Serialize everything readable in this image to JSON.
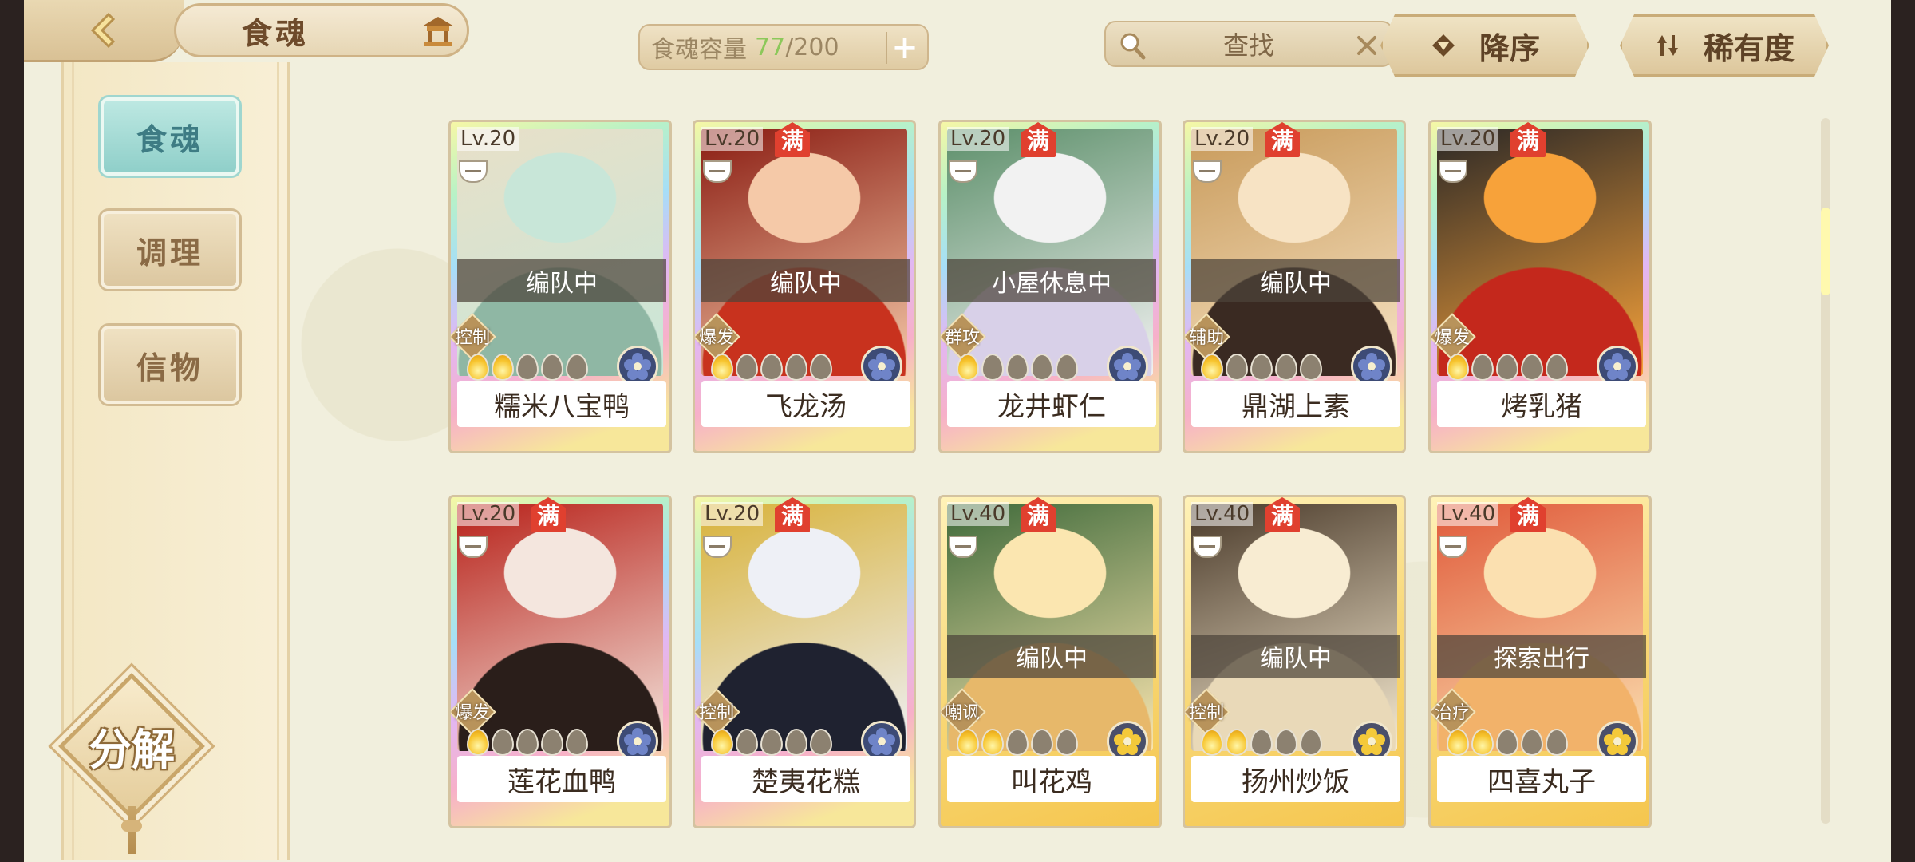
{
  "header": {
    "title": "食魂",
    "capacity_label": "食魂容量",
    "capacity_current": "77",
    "capacity_separator": "/",
    "capacity_max": "200",
    "capacity_add": "+",
    "search_label": "查找",
    "sort_order_label": "降序",
    "sort_by_label": "稀有度"
  },
  "sidebar": {
    "tabs": [
      {
        "label": "食魂",
        "active": true
      },
      {
        "label": "调理",
        "active": false
      },
      {
        "label": "信物",
        "active": false
      }
    ],
    "decompose_label": "分解"
  },
  "colors": {
    "background": "#f1efdd",
    "active_tab": "#8fcfc9",
    "full_badge": "#e0402f",
    "flame_on": "#f7c52f"
  },
  "cards": [
    {
      "level": "Lv.20",
      "full": "",
      "status": "编队中",
      "role": "控制",
      "flames_on": 2,
      "element_icon": "blue-flower-icon",
      "name": "糯米八宝鸭",
      "frame": "rainbow",
      "art": [
        "#c8e6d8",
        "#8fb7a4",
        "#e8e0c8"
      ]
    },
    {
      "level": "Lv.20",
      "full": "满",
      "status": "编队中",
      "role": "爆发",
      "flames_on": 1,
      "element_icon": "blue-flower-icon",
      "name": "飞龙汤",
      "frame": "rainbow",
      "art": [
        "#f5c9a8",
        "#c8321e",
        "#8a1c12"
      ]
    },
    {
      "level": "Lv.20",
      "full": "满",
      "status": "小屋休息中",
      "role": "群攻",
      "flames_on": 1,
      "element_icon": "blue-flower-icon",
      "name": "龙井虾仁",
      "frame": "rainbow",
      "art": [
        "#f2f2f2",
        "#d8d0e8",
        "#5c8f6a"
      ]
    },
    {
      "level": "Lv.20",
      "full": "满",
      "status": "编队中",
      "role": "辅助",
      "flames_on": 1,
      "element_icon": "blue-flower-icon",
      "name": "鼎湖上素",
      "frame": "rainbow",
      "art": [
        "#f7e3c4",
        "#3a2a22",
        "#c89a5a"
      ]
    },
    {
      "level": "Lv.20",
      "full": "满",
      "status": "",
      "role": "爆发",
      "flames_on": 1,
      "element_icon": "blue-flower-icon",
      "name": "烤乳猪",
      "frame": "rainbow",
      "art": [
        "#f7a23a",
        "#c4281c",
        "#2b2826"
      ]
    },
    {
      "level": "Lv.20",
      "full": "满",
      "status": "",
      "role": "爆发",
      "flames_on": 1,
      "element_icon": "blue-flower-icon",
      "name": "莲花血鸭",
      "frame": "rainbow",
      "art": [
        "#f4e6de",
        "#2a1e1a",
        "#b8221a"
      ]
    },
    {
      "level": "Lv.20",
      "full": "满",
      "status": "",
      "role": "控制",
      "flames_on": 1,
      "element_icon": "blue-flower-icon",
      "name": "楚夷花糕",
      "frame": "rainbow",
      "art": [
        "#eef0f6",
        "#1f2230",
        "#d8b23a"
      ]
    },
    {
      "level": "Lv.40",
      "full": "满",
      "status": "编队中",
      "role": "嘲讽",
      "flames_on": 2,
      "element_icon": "gold-flower-icon",
      "name": "叫花鸡",
      "frame": "gold",
      "art": [
        "#fbe6b0",
        "#e7b86a",
        "#3f6a3a"
      ]
    },
    {
      "level": "Lv.40",
      "full": "满",
      "status": "编队中",
      "role": "控制",
      "flames_on": 2,
      "element_icon": "gold-flower-icon",
      "name": "扬州炒饭",
      "frame": "gold",
      "art": [
        "#f8ecd2",
        "#e9d9b8",
        "#4a3a2a"
      ]
    },
    {
      "level": "Lv.40",
      "full": "满",
      "status": "探索出行",
      "role": "治疗",
      "flames_on": 2,
      "element_icon": "gold-flower-icon",
      "name": "四喜丸子",
      "frame": "gold",
      "art": [
        "#fbe0b0",
        "#f2b26a",
        "#e05a3a"
      ]
    }
  ]
}
